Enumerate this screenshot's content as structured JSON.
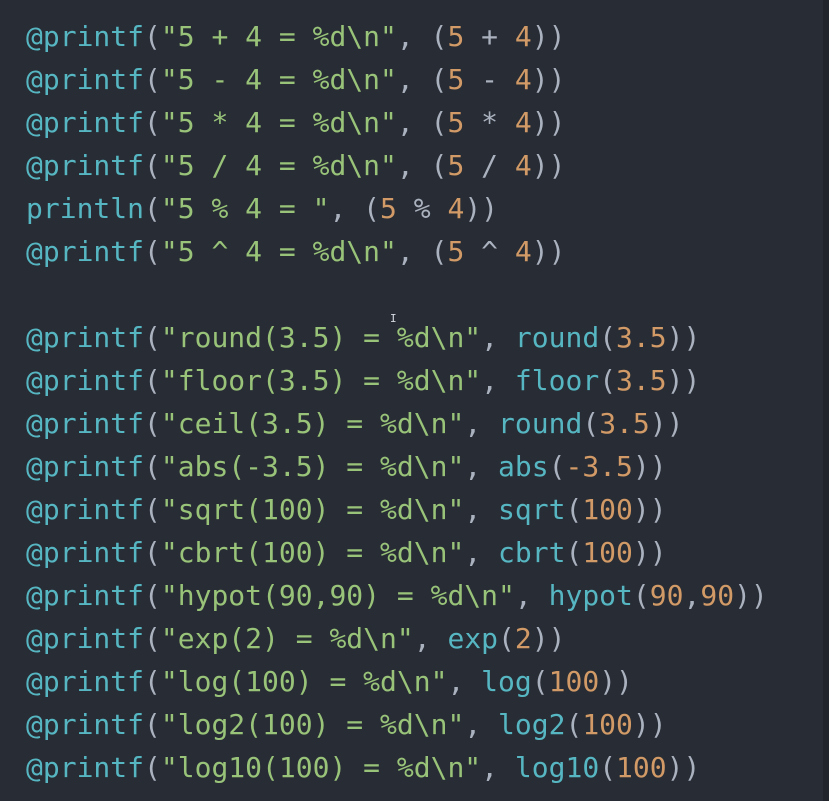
{
  "colors": {
    "background": "#282c34",
    "function": "#56b6c2",
    "string": "#98c379",
    "number": "#d19a66",
    "punctuation": "#abb2bf"
  },
  "lines": [
    [
      [
        "m",
        "@printf"
      ],
      [
        "p",
        "("
      ],
      [
        "s",
        "\"5 + 4 = %d\\n\""
      ],
      [
        "p",
        ", ("
      ],
      [
        "n",
        "5"
      ],
      [
        "p",
        " + "
      ],
      [
        "n",
        "4"
      ],
      [
        "p",
        "))"
      ]
    ],
    [
      [
        "m",
        "@printf"
      ],
      [
        "p",
        "("
      ],
      [
        "s",
        "\"5 - 4 = %d\\n\""
      ],
      [
        "p",
        ", ("
      ],
      [
        "n",
        "5"
      ],
      [
        "p",
        " - "
      ],
      [
        "n",
        "4"
      ],
      [
        "p",
        "))"
      ]
    ],
    [
      [
        "m",
        "@printf"
      ],
      [
        "p",
        "("
      ],
      [
        "s",
        "\"5 * 4 = %d\\n\""
      ],
      [
        "p",
        ", ("
      ],
      [
        "n",
        "5"
      ],
      [
        "p",
        " * "
      ],
      [
        "n",
        "4"
      ],
      [
        "p",
        "))"
      ]
    ],
    [
      [
        "m",
        "@printf"
      ],
      [
        "p",
        "("
      ],
      [
        "s",
        "\"5 / 4 = %d\\n\""
      ],
      [
        "p",
        ", ("
      ],
      [
        "n",
        "5"
      ],
      [
        "p",
        " / "
      ],
      [
        "n",
        "4"
      ],
      [
        "p",
        "))"
      ]
    ],
    [
      [
        "m",
        "println"
      ],
      [
        "p",
        "("
      ],
      [
        "s",
        "\"5 % 4 = \""
      ],
      [
        "p",
        ", ("
      ],
      [
        "n",
        "5"
      ],
      [
        "p",
        " % "
      ],
      [
        "n",
        "4"
      ],
      [
        "p",
        "))"
      ]
    ],
    [
      [
        "m",
        "@printf"
      ],
      [
        "p",
        "("
      ],
      [
        "s",
        "\"5 ^ 4 = %d\\n\""
      ],
      [
        "p",
        ", ("
      ],
      [
        "n",
        "5"
      ],
      [
        "p",
        " ^ "
      ],
      [
        "n",
        "4"
      ],
      [
        "p",
        "))"
      ]
    ],
    [],
    [
      [
        "m",
        "@printf"
      ],
      [
        "p",
        "("
      ],
      [
        "s",
        "\"round(3.5) = %d\\n\""
      ],
      [
        "p",
        ", "
      ],
      [
        "m",
        "round"
      ],
      [
        "p",
        "("
      ],
      [
        "n",
        "3.5"
      ],
      [
        "p",
        "))"
      ]
    ],
    [
      [
        "m",
        "@printf"
      ],
      [
        "p",
        "("
      ],
      [
        "s",
        "\"floor(3.5) = %d\\n\""
      ],
      [
        "p",
        ", "
      ],
      [
        "m",
        "floor"
      ],
      [
        "p",
        "("
      ],
      [
        "n",
        "3.5"
      ],
      [
        "p",
        "))"
      ]
    ],
    [
      [
        "m",
        "@printf"
      ],
      [
        "p",
        "("
      ],
      [
        "s",
        "\"ceil(3.5) = %d\\n\""
      ],
      [
        "p",
        ", "
      ],
      [
        "m",
        "round"
      ],
      [
        "p",
        "("
      ],
      [
        "n",
        "3.5"
      ],
      [
        "p",
        "))"
      ]
    ],
    [
      [
        "m",
        "@printf"
      ],
      [
        "p",
        "("
      ],
      [
        "s",
        "\"abs(-3.5) = %d\\n\""
      ],
      [
        "p",
        ", "
      ],
      [
        "m",
        "abs"
      ],
      [
        "p",
        "("
      ],
      [
        "n",
        "-3.5"
      ],
      [
        "p",
        "))"
      ]
    ],
    [
      [
        "m",
        "@printf"
      ],
      [
        "p",
        "("
      ],
      [
        "s",
        "\"sqrt(100) = %d\\n\""
      ],
      [
        "p",
        ", "
      ],
      [
        "m",
        "sqrt"
      ],
      [
        "p",
        "("
      ],
      [
        "n",
        "100"
      ],
      [
        "p",
        "))"
      ]
    ],
    [
      [
        "m",
        "@printf"
      ],
      [
        "p",
        "("
      ],
      [
        "s",
        "\"cbrt(100) = %d\\n\""
      ],
      [
        "p",
        ", "
      ],
      [
        "m",
        "cbrt"
      ],
      [
        "p",
        "("
      ],
      [
        "n",
        "100"
      ],
      [
        "p",
        "))"
      ]
    ],
    [
      [
        "m",
        "@printf"
      ],
      [
        "p",
        "("
      ],
      [
        "s",
        "\"hypot(90,90) = %d\\n\""
      ],
      [
        "p",
        ", "
      ],
      [
        "m",
        "hypot"
      ],
      [
        "p",
        "("
      ],
      [
        "n",
        "90"
      ],
      [
        "p",
        ","
      ],
      [
        "n",
        "90"
      ],
      [
        "p",
        "))"
      ]
    ],
    [
      [
        "m",
        "@printf"
      ],
      [
        "p",
        "("
      ],
      [
        "s",
        "\"exp(2) = %d\\n\""
      ],
      [
        "p",
        ", "
      ],
      [
        "m",
        "exp"
      ],
      [
        "p",
        "("
      ],
      [
        "n",
        "2"
      ],
      [
        "p",
        "))"
      ]
    ],
    [
      [
        "m",
        "@printf"
      ],
      [
        "p",
        "("
      ],
      [
        "s",
        "\"log(100) = %d\\n\""
      ],
      [
        "p",
        ", "
      ],
      [
        "m",
        "log"
      ],
      [
        "p",
        "("
      ],
      [
        "n",
        "100"
      ],
      [
        "p",
        "))"
      ]
    ],
    [
      [
        "m",
        "@printf"
      ],
      [
        "p",
        "("
      ],
      [
        "s",
        "\"log2(100) = %d\\n\""
      ],
      [
        "p",
        ", "
      ],
      [
        "m",
        "log2"
      ],
      [
        "p",
        "("
      ],
      [
        "n",
        "100"
      ],
      [
        "p",
        "))"
      ]
    ],
    [
      [
        "m",
        "@printf"
      ],
      [
        "p",
        "("
      ],
      [
        "s",
        "\"log10(100) = %d\\n\""
      ],
      [
        "p",
        ", "
      ],
      [
        "m",
        "log10"
      ],
      [
        "p",
        "("
      ],
      [
        "n",
        "100"
      ],
      [
        "p",
        "))"
      ]
    ]
  ]
}
